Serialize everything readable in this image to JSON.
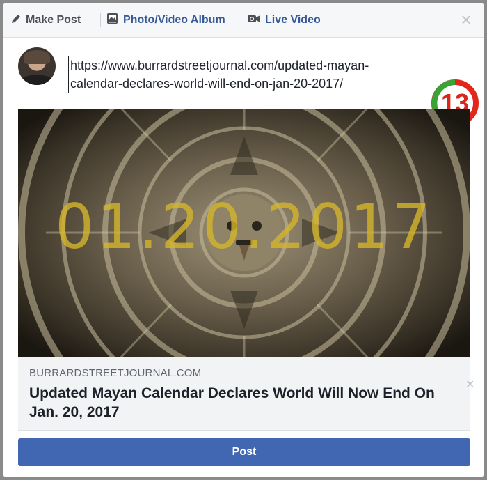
{
  "composer": {
    "tabs": [
      {
        "label": "Make Post",
        "icon": "pencil-icon"
      },
      {
        "label": "Photo/Video Album",
        "icon": "photo-album-icon"
      },
      {
        "label": "Live Video",
        "icon": "video-camera-icon"
      }
    ],
    "close_icon": "close-icon",
    "text": "https://www.burrardstreetjournal.com/updated-mayan-calendar-declares-world-will-end-on-jan-20-2017/",
    "badge": "13",
    "post_label": "Post"
  },
  "link_preview": {
    "image_text": "01.20.2017",
    "domain": "BURRARDSTREETJOURNAL.COM",
    "title": "Updated Mayan Calendar Declares World Will Now End On Jan. 20, 2017"
  },
  "colors": {
    "brand_blue": "#4267b2",
    "link_blue": "#365899",
    "badge_green": "#3aa335",
    "badge_red": "#e3261c",
    "image_date_color": "#d4b52a"
  }
}
